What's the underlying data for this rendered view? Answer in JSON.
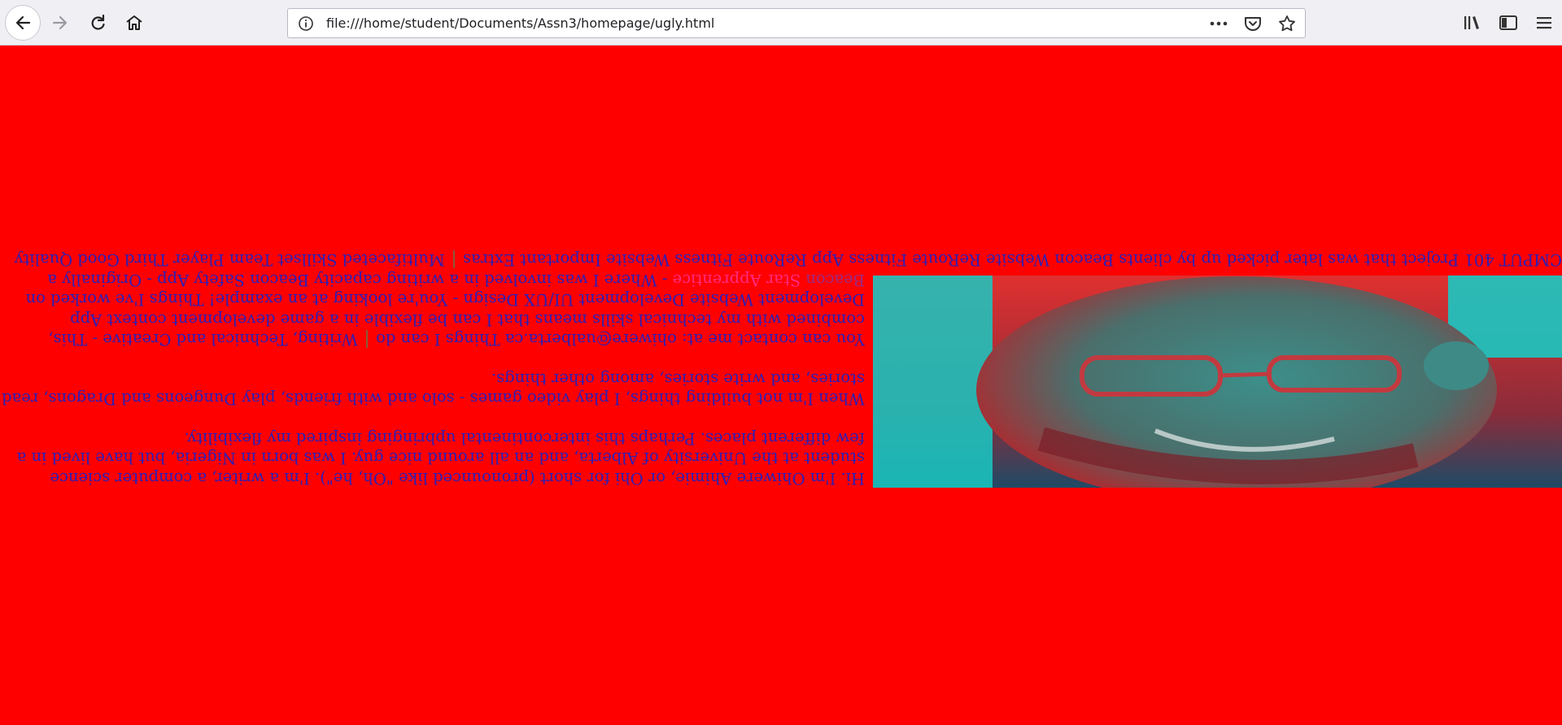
{
  "browser": {
    "url": "file:///home/student/Documents/Assn3/homepage/ugly.html",
    "icons": [
      "back-arrow-icon",
      "forward-arrow-icon",
      "reload-icon",
      "home-icon",
      "info-icon",
      "more-dots-icon",
      "pocket-icon",
      "bookmark-star-icon",
      "library-icon",
      "sidebar-icon",
      "menu-icon"
    ]
  },
  "page": {
    "background": "#ff0000",
    "text_color": "#2a1fb8",
    "photo_alt": "portrait photo",
    "intro": "Hi. I'm Ohiwere Ahimie, or Ohi for short (pronounced like \"Oh, he\"). I'm a writer, a computer science student at the University of Alberta, and an all around nice guy. I was born in Nigeria, but have lived in a few different places. Perhaps this intercontinental upbringing inspired my flexibility.",
    "hobbies": "When I'm not building things, I play video games - solo and with friends, play Dungeons and Dragons, read stories, and write stories, among other things.",
    "contact": "You can contact me at: ohiwere@ualberta.ca",
    "skills_heading": "Things I can do",
    "skills": "Writing, Technical and Creative - This, combined with my technical skills means that I can be flexible in a game development context App Development Website Development UI/UX Design - You're looking at an example!",
    "worked_heading": "Things I've worked on",
    "project1_link": "Beacon",
    "project2_link": "Star Apprentice",
    "worked_text": "- Where I was involved in a writing capacity Beacon Safety App - Originally a CMPUT 401 Project that was later picked up by clients Beacon Website ReRoute Fitness App ReRoute Fitness Website",
    "extras_heading": "Important Extras",
    "extras": "Multifaceted Skillset Team Player Third Good Quality"
  }
}
